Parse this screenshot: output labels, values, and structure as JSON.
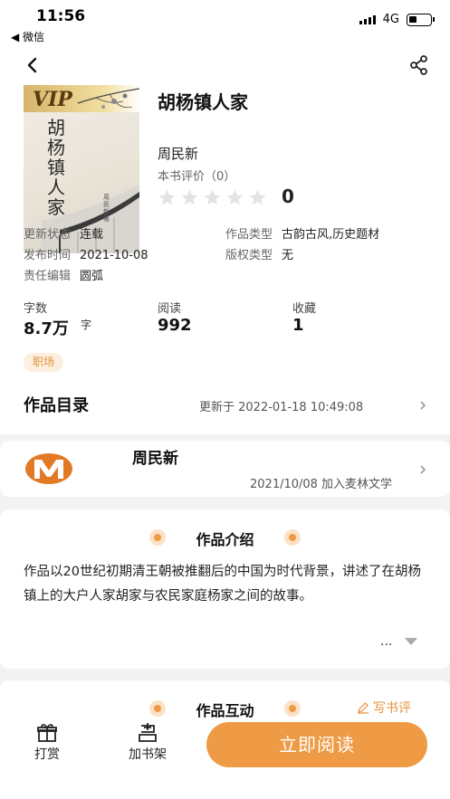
{
  "status_bar": {
    "time": "11:56",
    "back_app": "◀ 微信",
    "network": "4G"
  },
  "book": {
    "title": "胡杨镇人家",
    "author": "周民新",
    "rating_label": "本书评价（0）",
    "rating_score": "0",
    "stars_filled": 0,
    "cover": {
      "vip_label": "VIP",
      "title_vertical": "胡杨镇人家",
      "small_author": "周民新 著"
    }
  },
  "meta": [
    {
      "key": "更新状态",
      "value": "连载"
    },
    {
      "key": "作品类型",
      "value": "古韵古风,历史题材"
    },
    {
      "key": "发布时间",
      "value": "2021-10-08"
    },
    {
      "key": "版权类型",
      "value": "无"
    },
    {
      "key": "责任编辑",
      "value": "圆弧"
    }
  ],
  "stats": {
    "words_label": "字数",
    "words_value": "8.7万",
    "words_unit": "字",
    "reads_label": "阅读",
    "reads_value": "992",
    "favorites_label": "收藏",
    "favorites_value": "1"
  },
  "tag": "职场",
  "toc": {
    "title": "作品目录",
    "update_text": "更新于 2022-01-18 10:49:08"
  },
  "author_card": {
    "name": "周民新",
    "joined": "2021/10/08 加入麦林文学"
  },
  "intro": {
    "title": "作品介绍",
    "text": "作品以20世纪初期清王朝被推翻后的中国为时代背景，讲述了在胡杨镇上的大户人家胡家与农民家庭杨家之间的故事。",
    "ellipsis": "..."
  },
  "interact": {
    "title": "作品互动",
    "write_review": "写书评"
  },
  "bottom_bar": {
    "tip_label": "打赏",
    "shelf_label": "加书架",
    "read_button": "立即阅读"
  },
  "colors": {
    "accent": "#ef9a45",
    "tag_bg": "#fcefe0",
    "background": "#f3f3f3"
  }
}
